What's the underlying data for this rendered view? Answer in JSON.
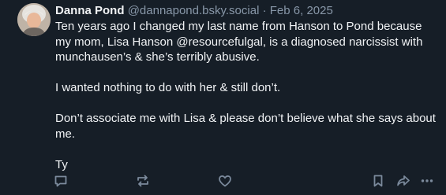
{
  "post": {
    "author": {
      "display_name": "Danna Pond",
      "handle": "@dannapond.bsky.social"
    },
    "separator": "·",
    "date": "Feb 6, 2025",
    "paragraphs": [
      "Ten years ago I changed my last name from Hanson to Pond because my mom, Lisa Hanson @resourcefulgal, is a diagnosed narcissist with munchausen’s & she’s terribly abusive.",
      "I wanted nothing to do with her & still don’t.",
      "Don’t associate me with Lisa & please don’t believe what she says about me.",
      "Ty"
    ]
  },
  "actions": [
    {
      "icon": "reply-icon"
    },
    {
      "icon": "repost-icon"
    },
    {
      "icon": "like-icon"
    },
    {
      "icon": "bookmark-icon"
    },
    {
      "icon": "share-icon"
    },
    {
      "icon": "more-icon"
    }
  ],
  "colors": {
    "background": "#161e27",
    "text": "#f1f3f5",
    "muted": "#8897a8",
    "icon": "#7b8a9c"
  }
}
